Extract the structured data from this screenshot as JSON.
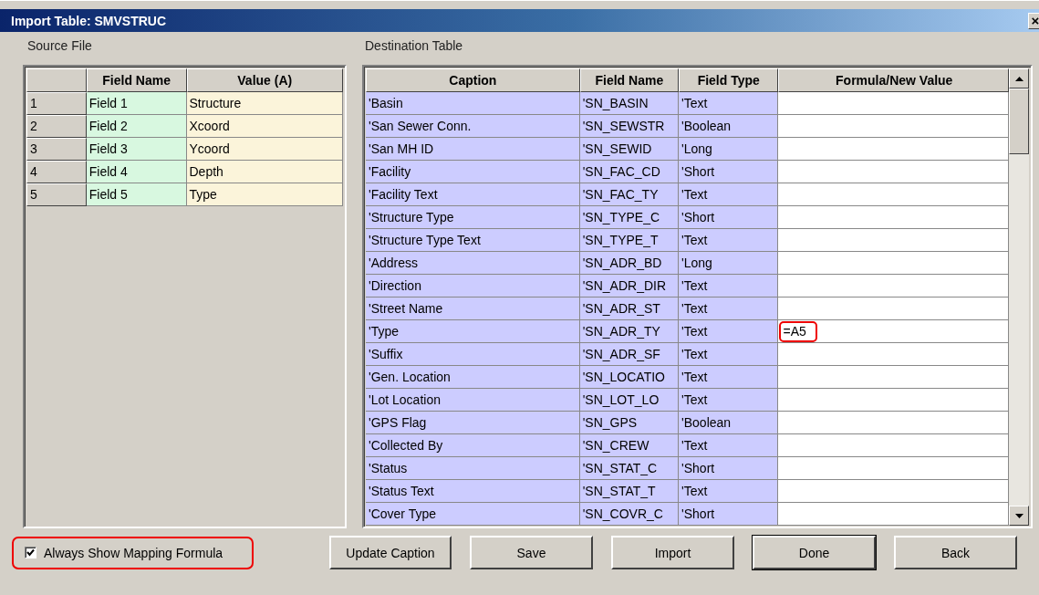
{
  "window": {
    "title": "Import Table: SMVSTRUC",
    "close": "×"
  },
  "source": {
    "label": "Source File",
    "columns": [
      "Field Name",
      "Value (A)"
    ],
    "rows": [
      {
        "num": "1",
        "field_name": "Field 1",
        "value": "Structure"
      },
      {
        "num": "2",
        "field_name": "Field 2",
        "value": "Xcoord"
      },
      {
        "num": "3",
        "field_name": "Field 3",
        "value": "Ycoord"
      },
      {
        "num": "4",
        "field_name": "Field 4",
        "value": "Depth"
      },
      {
        "num": "5",
        "field_name": "Field 5",
        "value": "Type"
      }
    ]
  },
  "destination": {
    "label": "Destination Table",
    "columns": [
      "Caption",
      "Field Name",
      "Field Type",
      "Formula/New Value"
    ],
    "rows": [
      {
        "caption": "'Basin",
        "field_name": "'SN_BASIN",
        "field_type": "'Text"
      },
      {
        "caption": "'San Sewer Conn.",
        "field_name": "'SN_SEWSTR",
        "field_type": "'Boolean"
      },
      {
        "caption": "'San MH ID",
        "field_name": "'SN_SEWID",
        "field_type": "'Long"
      },
      {
        "caption": "'Facility",
        "field_name": "'SN_FAC_CD",
        "field_type": "'Short"
      },
      {
        "caption": "'Facility Text",
        "field_name": "'SN_FAC_TY",
        "field_type": "'Text"
      },
      {
        "caption": "'Structure Type",
        "field_name": "'SN_TYPE_C",
        "field_type": "'Short"
      },
      {
        "caption": "'Structure Type Text",
        "field_name": "'SN_TYPE_T",
        "field_type": "'Text"
      },
      {
        "caption": "'Address",
        "field_name": "'SN_ADR_BD",
        "field_type": "'Long"
      },
      {
        "caption": "'Direction",
        "field_name": "'SN_ADR_DIR",
        "field_type": "'Text"
      },
      {
        "caption": "'Street Name",
        "field_name": "'SN_ADR_ST",
        "field_type": "'Text"
      },
      {
        "caption": "'Type",
        "field_name": "'SN_ADR_TY",
        "field_type": "'Text",
        "formula": "=A5",
        "circled": true
      },
      {
        "caption": "'Suffix",
        "field_name": "'SN_ADR_SF",
        "field_type": "'Text"
      },
      {
        "caption": "'Gen. Location",
        "field_name": "'SN_LOCATIO",
        "field_type": "'Text"
      },
      {
        "caption": "'Lot Location",
        "field_name": "'SN_LOT_LO",
        "field_type": "'Text"
      },
      {
        "caption": "'GPS Flag",
        "field_name": "'SN_GPS",
        "field_type": "'Boolean"
      },
      {
        "caption": "'Collected By",
        "field_name": "'SN_CREW",
        "field_type": "'Text"
      },
      {
        "caption": "'Status",
        "field_name": "'SN_STAT_C",
        "field_type": "'Short"
      },
      {
        "caption": "'Status Text",
        "field_name": "'SN_STAT_T",
        "field_type": "'Text"
      },
      {
        "caption": "'Cover Type",
        "field_name": "'SN_COVR_C",
        "field_type": "'Short"
      }
    ]
  },
  "always_show_mapping_formula": {
    "label": "Always Show Mapping Formula",
    "checked": true,
    "circled": true
  },
  "buttons": [
    {
      "label": "Update Caption",
      "default": false
    },
    {
      "label": "Save",
      "default": false
    },
    {
      "label": "Import",
      "default": false
    },
    {
      "label": "Done",
      "default": true
    },
    {
      "label": "Back",
      "default": false
    }
  ]
}
